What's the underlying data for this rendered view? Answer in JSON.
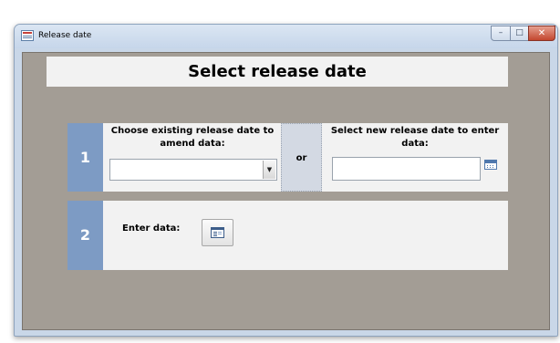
{
  "window": {
    "title": "Release date",
    "icon": "access-form-icon",
    "controls": {
      "minimize": "minimize-icon",
      "maximize": "maximize-icon",
      "close": "close-icon"
    }
  },
  "form": {
    "heading": "Select release date",
    "section1": {
      "number": "1",
      "existing_label": "Choose existing release date to amend data:",
      "existing_value": "",
      "or_text": "or",
      "new_label": "Select new release date to enter data:",
      "new_value": ""
    },
    "section2": {
      "number": "2",
      "enter_label": "Enter data:"
    }
  },
  "colors": {
    "client_background": "#a39d95",
    "section_number_background": "#7d9bc4",
    "panel_background": "#f2f2f2"
  }
}
